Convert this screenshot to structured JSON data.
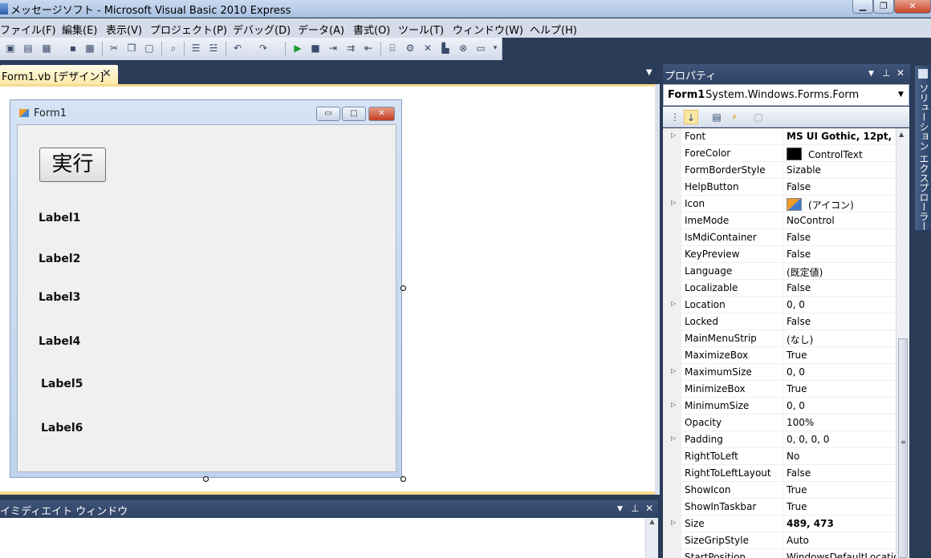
{
  "window": {
    "title": "メッセージソフト - Microsoft Visual Basic 2010 Express",
    "min": "▁",
    "max": "❐",
    "close": "✕"
  },
  "menu": [
    {
      "label": "ファイル(F)"
    },
    {
      "label": "編集(E)"
    },
    {
      "label": "表示(V)"
    },
    {
      "label": "プロジェクト(P)"
    },
    {
      "label": "デバッグ(D)"
    },
    {
      "label": "データ(A)"
    },
    {
      "label": "書式(O)"
    },
    {
      "label": "ツール(T)"
    },
    {
      "label": "ウィンドウ(W)"
    },
    {
      "label": "ヘルプ(H)"
    }
  ],
  "document_tab": {
    "label": "Form1.vb [デザイン]",
    "close": "✕",
    "dropdown": "▼"
  },
  "form": {
    "title": "Form1",
    "min": "▭",
    "max": "□",
    "close": "✕",
    "button_label": "実行",
    "labels": [
      "Label1",
      "Label2",
      "Label3",
      "Label4",
      "Label5",
      "Label6"
    ]
  },
  "immediate_window": {
    "title": "イミディエイト ウィンドウ",
    "dropdown": "▼",
    "pin": "⊥",
    "close": "✕",
    "scroll_up": "▲"
  },
  "properties": {
    "title": "プロパティ",
    "dropdown": "▼",
    "pin": "⊥",
    "close": "✕",
    "object_name": "Form1",
    "object_type": "System.Windows.Forms.Form",
    "object_dropdown": "▼",
    "rows": [
      {
        "name": "Font",
        "value": "MS UI Gothic, 12pt, s",
        "expandable": true,
        "bold": true
      },
      {
        "name": "ForeColor",
        "value": "ControlText",
        "swatch": "color"
      },
      {
        "name": "FormBorderStyle",
        "value": "Sizable"
      },
      {
        "name": "HelpButton",
        "value": "False"
      },
      {
        "name": "Icon",
        "value": "(アイコン)",
        "expandable": true,
        "swatch": "icon"
      },
      {
        "name": "ImeMode",
        "value": "NoControl"
      },
      {
        "name": "IsMdiContainer",
        "value": "False"
      },
      {
        "name": "KeyPreview",
        "value": "False"
      },
      {
        "name": "Language",
        "value": "(既定値)"
      },
      {
        "name": "Localizable",
        "value": "False"
      },
      {
        "name": "Location",
        "value": "0, 0",
        "expandable": true
      },
      {
        "name": "Locked",
        "value": "False"
      },
      {
        "name": "MainMenuStrip",
        "value": "(なし)"
      },
      {
        "name": "MaximizeBox",
        "value": "True"
      },
      {
        "name": "MaximumSize",
        "value": "0, 0",
        "expandable": true
      },
      {
        "name": "MinimizeBox",
        "value": "True"
      },
      {
        "name": "MinimumSize",
        "value": "0, 0",
        "expandable": true
      },
      {
        "name": "Opacity",
        "value": "100%"
      },
      {
        "name": "Padding",
        "value": "0, 0, 0, 0",
        "expandable": true
      },
      {
        "name": "RightToLeft",
        "value": "No"
      },
      {
        "name": "RightToLeftLayout",
        "value": "False"
      },
      {
        "name": "ShowIcon",
        "value": "True"
      },
      {
        "name": "ShowInTaskbar",
        "value": "True"
      },
      {
        "name": "Size",
        "value": "489, 473",
        "expandable": true,
        "bold": true
      },
      {
        "name": "SizeGripStyle",
        "value": "Auto"
      },
      {
        "name": "StartPosition",
        "value": "WindowsDefaultLocatio"
      }
    ],
    "expander_glyph": "▷",
    "scroll_up": "▲",
    "scroll_grip": "≡"
  },
  "solution_explorer_tab": {
    "label": "ソリューション エクスプローラー"
  },
  "colors": {
    "ide_background": "#2b3c59",
    "designer_highlight": "#f5dc8e",
    "tool_window_title": "#2e4264"
  }
}
